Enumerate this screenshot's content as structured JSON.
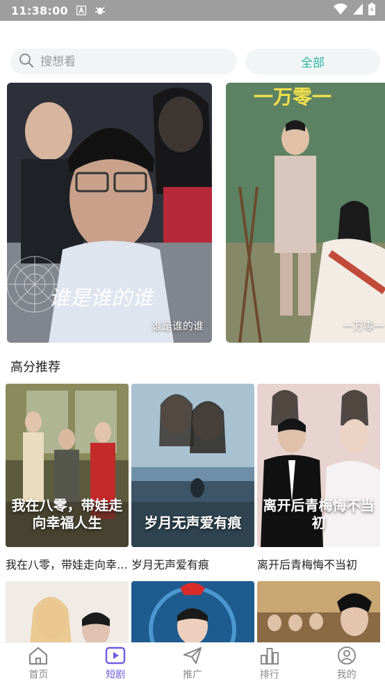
{
  "status_bar": {
    "time": "11:38:00",
    "icons": [
      "a-notification-icon",
      "bug-icon",
      "wifi-icon",
      "signal-icon",
      "battery-icon"
    ]
  },
  "search": {
    "placeholder": "搜想看",
    "filter_label": "全部",
    "accent_color": "#2bb3a3"
  },
  "banner": {
    "items": [
      {
        "caption": "谁是谁的谁"
      },
      {
        "caption": "一万零一"
      }
    ]
  },
  "section": {
    "title": "高分推荐"
  },
  "cards": [
    {
      "title": "我在八零，带娃走向幸福人生",
      "poster_text": "我在八零，带娃走向幸福人生"
    },
    {
      "title": "岁月无声爱有痕",
      "poster_text": "岁月无声爱有痕"
    },
    {
      "title": "离开后青梅悔不当初",
      "poster_text": "离开后青梅悔不当初"
    },
    {
      "title": ""
    },
    {
      "title": ""
    },
    {
      "title": ""
    }
  ],
  "tabbar": {
    "active_color": "#6b5ce0",
    "items": [
      {
        "label": "首页",
        "icon": "home-icon"
      },
      {
        "label": "短剧",
        "icon": "play-icon"
      },
      {
        "label": "推广",
        "icon": "send-icon"
      },
      {
        "label": "排行",
        "icon": "bar-chart-icon"
      },
      {
        "label": "我的",
        "icon": "user-icon"
      }
    ]
  }
}
